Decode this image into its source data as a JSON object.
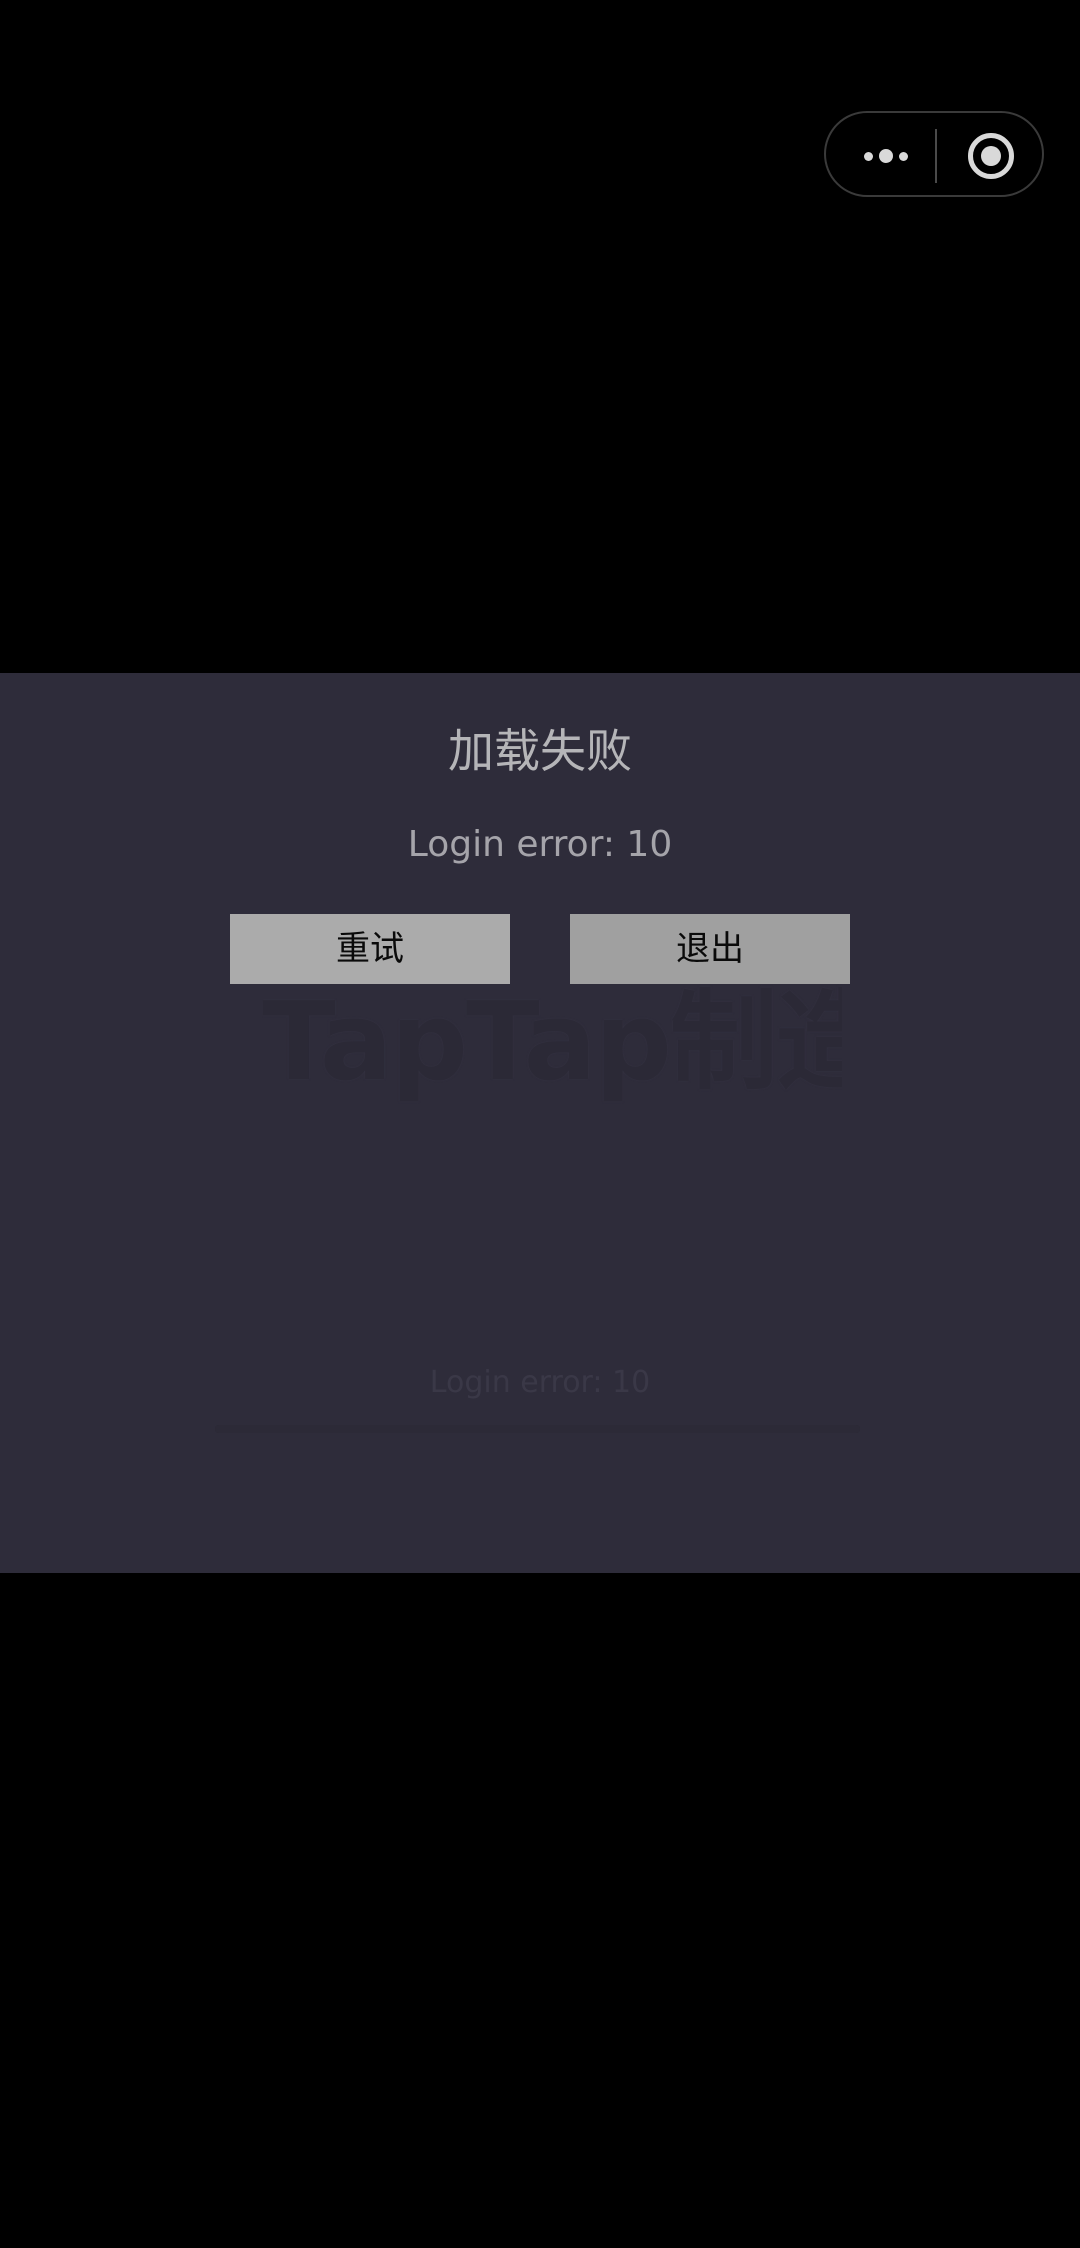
{
  "capsule": {
    "more_icon": "more-dots-icon",
    "close_icon": "target-circle-icon"
  },
  "background": {
    "logo_text": "TapTap制造",
    "status_text": "Login error: 10",
    "progress": 1.0
  },
  "dialog": {
    "title": "加载失败",
    "message": "Login error: 10",
    "retry_label": "重试",
    "exit_label": "退出"
  },
  "colors": {
    "screen_bg": "#000000",
    "panel_bg": "#2e2c3a",
    "retry_button_bg": "#ababab",
    "exit_button_bg": "#a0a0a0",
    "title_text": "#b5b5b8"
  }
}
